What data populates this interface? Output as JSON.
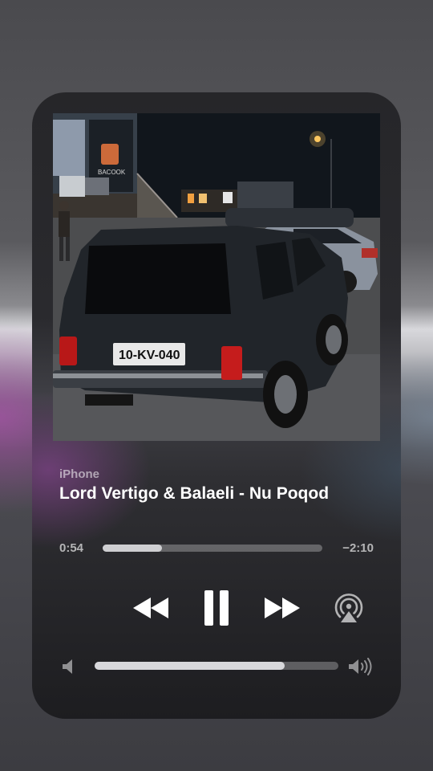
{
  "now_playing": {
    "source": "iPhone",
    "title": "Lord Vertigo & Balaeli - Nu Poqod",
    "artwork": {
      "description": "night photo of a dark car parked in a lot",
      "plate_text": "10-KV-040",
      "sign_text": "BACOOK"
    },
    "elapsed": "0:54",
    "remaining": "−2:10",
    "progress_fraction": 0.27,
    "volume_fraction": 0.78
  },
  "controls": {
    "rewind_icon": "backward-icon",
    "pause_icon": "pause-icon",
    "forward_icon": "forward-icon",
    "airplay_icon": "airplay-icon",
    "volume_low_icon": "speaker-low-icon",
    "volume_high_icon": "speaker-high-icon"
  },
  "colors": {
    "accent": "#ffffff",
    "track": "#5a5a5f",
    "fill": "#cfcfd2"
  }
}
